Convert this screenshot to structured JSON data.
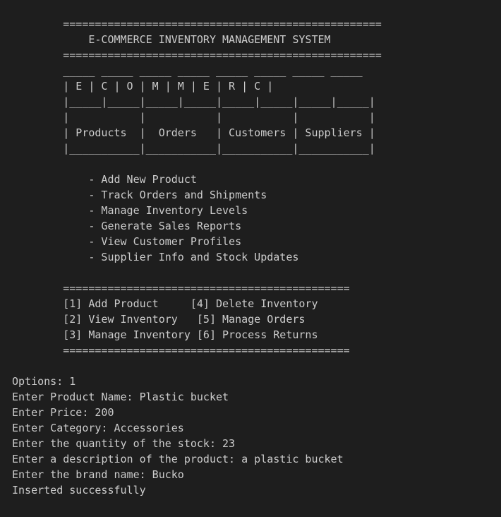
{
  "banner": {
    "rule_top": "        ==================================================",
    "title": "            E-COMMERCE INVENTORY MANAGEMENT SYSTEM",
    "rule_bottom": "        =================================================="
  },
  "ascii_art": [
    "        _____ _____ _____ _____ _____ _____ _____ _____",
    "        | E | C | O | M | M | E | R | C |",
    "        |_____|_____|_____|_____|_____|_____|_____|_____|",
    "        |           |           |           |           |",
    "        | Products  |  Orders   | Customers | Suppliers |",
    "        |___________|___________|___________|___________|"
  ],
  "features": [
    "            - Add New Product",
    "            - Track Orders and Shipments",
    "            - Manage Inventory Levels",
    "            - Generate Sales Reports",
    "            - View Customer Profiles",
    "            - Supplier Info and Stock Updates"
  ],
  "menu": {
    "rule_top": "        =============================================",
    "rows": [
      "        [1] Add Product     [4] Delete Inventory",
      "        [2] View Inventory   [5] Manage Orders",
      "        [3] Manage Inventory [6] Process Returns"
    ],
    "rule_bottom": "        ============================================="
  },
  "session": [
    "Options: 1",
    "Enter Product Name: Plastic bucket",
    "Enter Price: 200",
    "Enter Category: Accessories",
    "Enter the quantity of the stock: 23",
    "Enter a description of the product: a plastic bucket",
    "Enter the brand name: Bucko",
    "Inserted successfully"
  ],
  "colors": {
    "background": "#1e1e1e",
    "text": "#cccccc"
  }
}
